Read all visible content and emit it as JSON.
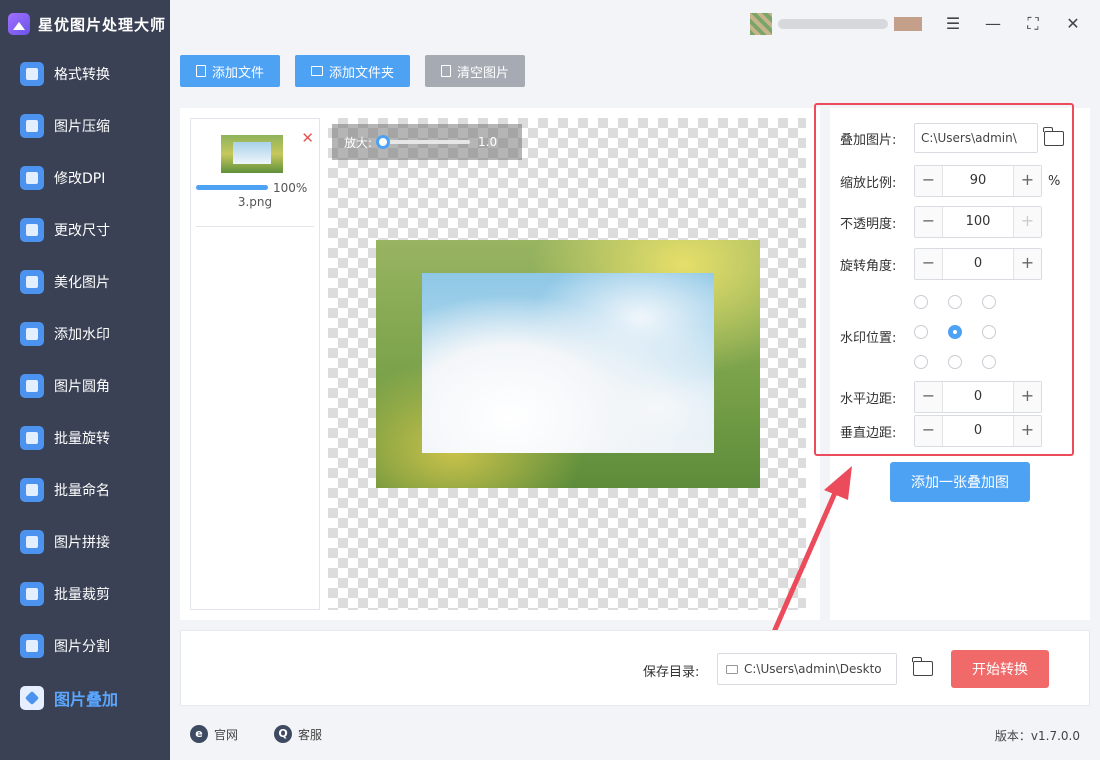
{
  "app": {
    "title": "星优图片处理大师"
  },
  "sidebar": {
    "items": [
      {
        "label": "格式转换",
        "icon": "format-convert-icon"
      },
      {
        "label": "图片压缩",
        "icon": "compress-icon"
      },
      {
        "label": "修改DPI",
        "icon": "dpi-icon"
      },
      {
        "label": "更改尺寸",
        "icon": "resize-icon"
      },
      {
        "label": "美化图片",
        "icon": "beautify-icon"
      },
      {
        "label": "添加水印",
        "icon": "watermark-icon"
      },
      {
        "label": "图片圆角",
        "icon": "round-corner-icon"
      },
      {
        "label": "批量旋转",
        "icon": "rotate-icon"
      },
      {
        "label": "批量命名",
        "icon": "rename-icon"
      },
      {
        "label": "图片拼接",
        "icon": "stitch-icon"
      },
      {
        "label": "批量裁剪",
        "icon": "crop-icon"
      },
      {
        "label": "图片分割",
        "icon": "split-icon"
      },
      {
        "label": "图片叠加",
        "icon": "layers-icon",
        "active": true
      }
    ]
  },
  "toolbar": {
    "add_file": "添加文件",
    "add_folder": "添加文件夹",
    "clear": "清空图片"
  },
  "file_list": {
    "items": [
      {
        "name": "3.png",
        "progress_label": "100%",
        "progress": 1.0
      }
    ]
  },
  "preview": {
    "zoom_label": "放大:",
    "zoom_value": "1.0"
  },
  "settings": {
    "overlay_label": "叠加图片:",
    "overlay_path": "C:\\Users\\admin\\",
    "scale_label": "缩放比例:",
    "scale_value": "90",
    "scale_unit": "%",
    "opacity_label": "不透明度:",
    "opacity_value": "100",
    "rotation_label": "旋转角度:",
    "rotation_value": "0",
    "position_label": "水印位置:",
    "position_selected": "center",
    "h_margin_label": "水平边距:",
    "h_margin_value": "0",
    "v_margin_label": "垂直边距:",
    "v_margin_value": "0",
    "add_overlay_button": "添加一张叠加图"
  },
  "bottom": {
    "save_label": "保存目录:",
    "save_path": "C:\\Users\\admin\\Deskto",
    "start_button": "开始转换"
  },
  "footer": {
    "website": "官网",
    "support": "客服",
    "version": "版本：v1.7.0.0"
  },
  "colors": {
    "sidebar_bg": "#3a4154",
    "accent": "#4ea2f4",
    "start_button": "#f06a6a",
    "highlight": "#ec4b5c"
  }
}
